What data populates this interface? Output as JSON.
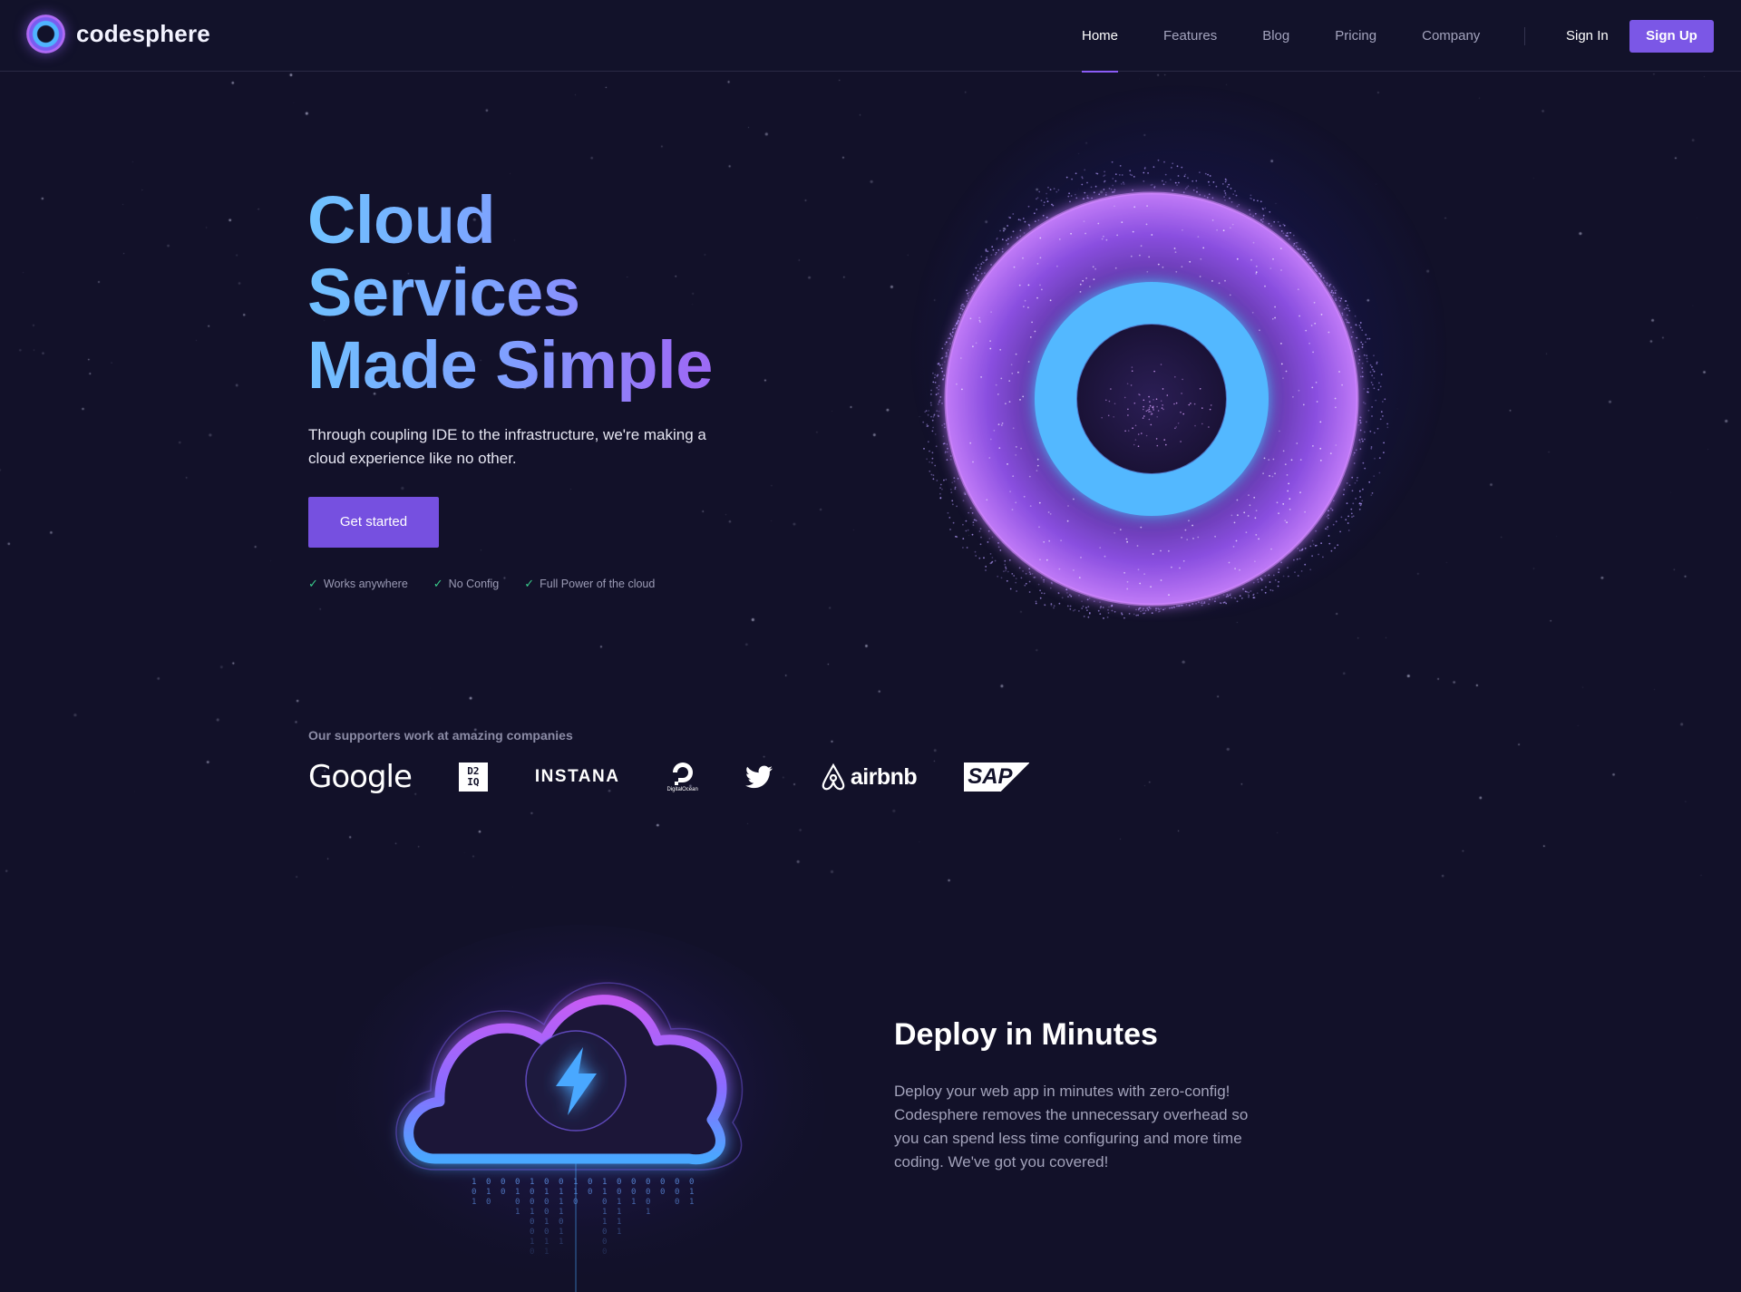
{
  "brand": {
    "name": "codesphere",
    "logo_icon": "ring-logo-icon"
  },
  "nav": {
    "items": [
      {
        "label": "Home",
        "active": true
      },
      {
        "label": "Features",
        "active": false
      },
      {
        "label": "Blog",
        "active": false
      },
      {
        "label": "Pricing",
        "active": false
      },
      {
        "label": "Company",
        "active": false
      }
    ],
    "signin": "Sign In",
    "signup": "Sign Up"
  },
  "hero": {
    "title_lines": [
      "Cloud",
      "Services",
      "Made Simple"
    ],
    "subtitle": "Through coupling IDE to the infrastructure, we're making a cloud experience like no other.",
    "cta": "Get started",
    "features": [
      "Works anywhere",
      "No Config",
      "Full Power of the cloud"
    ]
  },
  "supporters": {
    "title": "Our supporters work at amazing companies",
    "logos": {
      "google": "Google",
      "d2iq_top": "D2",
      "d2iq_bottom": "IQ",
      "instana": "INSTANA",
      "digitalocean": "DigitalOcean",
      "twitter": "twitter-bird-icon",
      "airbnb": "airbnb",
      "sap": "SAP"
    }
  },
  "deploy": {
    "title": "Deploy in Minutes",
    "body": "Deploy your web app in minutes with zero-config! Codesphere removes the unnecessary overhead so you can spend less time configuring and more time coding. We've got you covered!"
  },
  "colors": {
    "background": "#121129",
    "accent": "#7b57e6",
    "cyan": "#4fb4ff",
    "check": "#39c98a"
  }
}
